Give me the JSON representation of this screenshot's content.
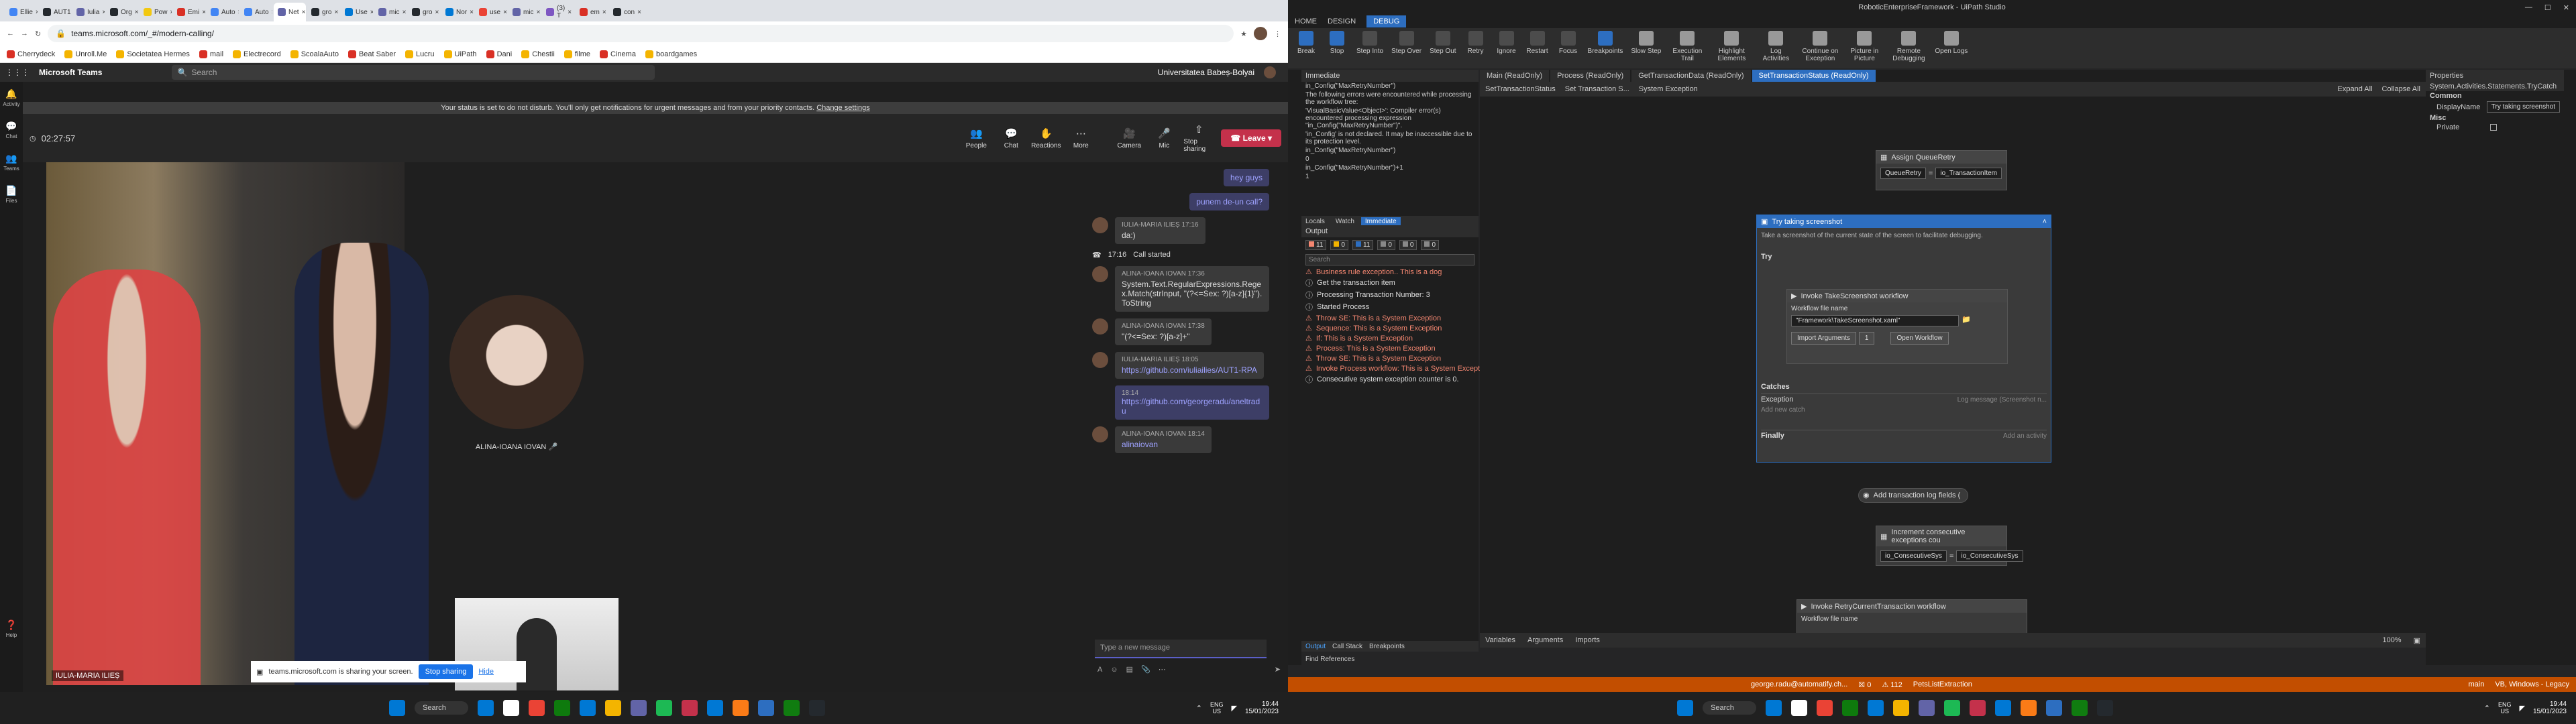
{
  "chrome": {
    "tabs": [
      "Ellie",
      "AUT1",
      "Iulia",
      "Org",
      "Pow",
      "Emi",
      "Auto",
      "Auto",
      "Net",
      "gro",
      "Use",
      "mic",
      "gro",
      "Nor",
      "use",
      "mic",
      "(3) T",
      "em",
      "con"
    ],
    "url": "teams.microsoft.com/_#/modern-calling/",
    "bookmarks": [
      "Cherrydeck",
      "Unroll.Me",
      "Societatea Hermes",
      "mail",
      "Electrecord",
      "ScoalaAuto",
      "Beat Saber",
      "Lucru",
      "UiPath",
      "Dani",
      "Chestii",
      "filme",
      "Cinema",
      "boardgames"
    ]
  },
  "teams": {
    "app": "Microsoft Teams",
    "search": "Search",
    "org": "Universitatea Babeș-Bolyai",
    "rail": [
      "Activity",
      "Chat",
      "Teams",
      "Files",
      "Help"
    ],
    "banner": "Your status is set to do not disturb. You'll only get notifications for urgent messages and from your priority contacts.",
    "banner_link": "Change settings",
    "timer": "02:27:57",
    "controls": [
      "People",
      "Chat",
      "Reactions",
      "More",
      "Camera",
      "Mic",
      "Stop sharing"
    ],
    "leave": "Leave",
    "participant_left": "IULIA-MARIA ILIEȘ",
    "participant_avatar": "ALINA-IOANA IOVAN",
    "sharing": "teams.microsoft.com is sharing your screen.",
    "stop_sharing": "Stop sharing",
    "hide": "Hide",
    "chat": [
      {
        "mine": true,
        "text": "hey guys"
      },
      {
        "mine": true,
        "text": "punem de-un call?"
      },
      {
        "name": "IULIA-MARIA ILIEȘ",
        "time": "17:16",
        "text": "da:)"
      },
      {
        "system": true,
        "time": "17:16",
        "text": "Call started"
      },
      {
        "name": "ALINA-IOANA IOVAN",
        "time": "17:36",
        "text": "System.Text.RegularExpressions.Regex.Match(strInput, \"(?<=Sex: ?)[a-z]{1}\").ToString"
      },
      {
        "name": "ALINA-IOANA IOVAN",
        "time": "17:38",
        "text": "\"(?<=Sex: ?)[a-z]+\""
      },
      {
        "name": "IULIA-MARIA ILIEȘ",
        "time": "18:05",
        "text": "https://github.com/iuliailies/AUT1-RPA"
      },
      {
        "mine": true,
        "time": "18:14",
        "text": "https://github.com/georgeradu/aneltradu"
      },
      {
        "name": "ALINA-IOANA IOVAN",
        "time": "18:14",
        "text": "alinaiovan"
      }
    ],
    "compose": "Type a new message"
  },
  "taskbar_left": {
    "search": "Search",
    "lang": "ENG\nUS",
    "time": "19:44",
    "date": "15/01/2023"
  },
  "uipath": {
    "title": "RoboticEnterpriseFramework - UiPath Studio",
    "tabs": [
      "HOME",
      "DESIGN",
      "DEBUG"
    ],
    "ribbon": [
      "Break",
      "Stop",
      "Step Into",
      "Step Over",
      "Step Out",
      "Retry",
      "Ignore",
      "Restart",
      "Focus",
      "Breakpoints",
      "Slow Step",
      "Execution Trail",
      "Highlight Elements",
      "Log Activities",
      "Continue on Exception",
      "Picture in Picture",
      "Remote Debugging",
      "Open Logs"
    ],
    "immediate_title": "Immediate",
    "immediate": [
      "in_Config(\"MaxRetryNumber\")",
      "The following errors were encountered while processing the workflow tree:",
      "'VisualBasicValue<Object>': Compiler error(s) encountered processing expression \"in_Config(\"MaxRetryNumber\")\".",
      "'in_Config' is not declared. It may be inaccessible due to its protection level.",
      "in_Config(\"MaxRetryNumber\")",
      "0",
      "in_Config(\"MaxRetryNumber\")+1",
      "1"
    ],
    "immediate_tabs": [
      "Locals",
      "Watch",
      "Immediate"
    ],
    "output_title": "Output",
    "output_counts": [
      "11",
      "0",
      "11",
      "0",
      "0",
      "0"
    ],
    "output_search": "Search",
    "output": [
      {
        "w": true,
        "t": "Business rule exception.. This is a dog"
      },
      {
        "w": false,
        "t": "Get the transaction item"
      },
      {
        "w": false,
        "t": "Processing Transaction Number: 3"
      },
      {
        "w": false,
        "t": "Started Process"
      },
      {
        "w": true,
        "t": "Throw SE: This is a System Exception"
      },
      {
        "w": true,
        "t": "Sequence: This is a System Exception"
      },
      {
        "w": true,
        "t": "If: This is a System Exception"
      },
      {
        "w": true,
        "t": "Process: This is a System Exception"
      },
      {
        "w": true,
        "t": "Throw SE: This is a System Exception"
      },
      {
        "w": true,
        "t": "Invoke Process workflow: This is a System Exception"
      },
      {
        "w": false,
        "t": "Consecutive system exception counter is 0."
      }
    ],
    "output_tabs": [
      "Output",
      "Call Stack",
      "Breakpoints"
    ],
    "find_refs": "Find References",
    "doc_tabs": [
      "Main (ReadOnly)",
      "Process (ReadOnly)",
      "GetTransactionData (ReadOnly)",
      "SetTransactionStatus (ReadOnly)"
    ],
    "breadcrumb": [
      "SetTransactionStatus",
      "Set Transaction S...",
      "System Exception"
    ],
    "expand": "Expand All",
    "collapse": "Collapse All",
    "assign_title": "Assign QueueRetry",
    "assign_left": "QueueRetry",
    "assign_right": "io_TransactionItem",
    "try_title": "Try taking screenshot",
    "try_desc": "Take a screenshot of the current state of the screen to facilitate debugging.",
    "try_label": "Try",
    "invoke_title": "Invoke TakeScreenshot workflow",
    "wf_label": "Workflow file name",
    "wf_value": "\"Framework\\TakeScreenshot.xaml\"",
    "import_args": "Import Arguments",
    "import_count": "1",
    "open_wf": "Open Workflow",
    "catches": "Catches",
    "exception": "Exception",
    "log_msg": "Log message (Screenshot n...",
    "add_catch": "Add new catch",
    "finally": "Finally",
    "add_activity": "Add an activity",
    "add_log": "Add transaction log fields (",
    "inc_title": "Increment consecutive exceptions cou",
    "inc_left": "io_ConsecutiveSys",
    "inc_right": "io_ConsecutiveSys",
    "invoke_retry": "Invoke RetryCurrentTransaction workflow",
    "invoke_retry_label": "Workflow file name",
    "bottom_tabs": [
      "Variables",
      "Arguments",
      "Imports"
    ],
    "zoom": "100%",
    "properties_title": "Properties",
    "prop_type": "System.Activities.Statements.TryCatch",
    "prop_common": "Common",
    "prop_display": "DisplayName",
    "prop_display_val": "Try taking screenshot",
    "prop_misc": "Misc",
    "prop_private": "Private",
    "status": {
      "user": "george.radu@automatify.ch...",
      "errors": "0",
      "warnings": "112",
      "project": "PetsListExtraction",
      "branch": "main",
      "target": "VB, Windows - Legacy"
    }
  },
  "taskbar_right": {
    "search": "Search",
    "lang": "ENG\nUS",
    "time": "19:44",
    "date": "15/01/2023"
  }
}
